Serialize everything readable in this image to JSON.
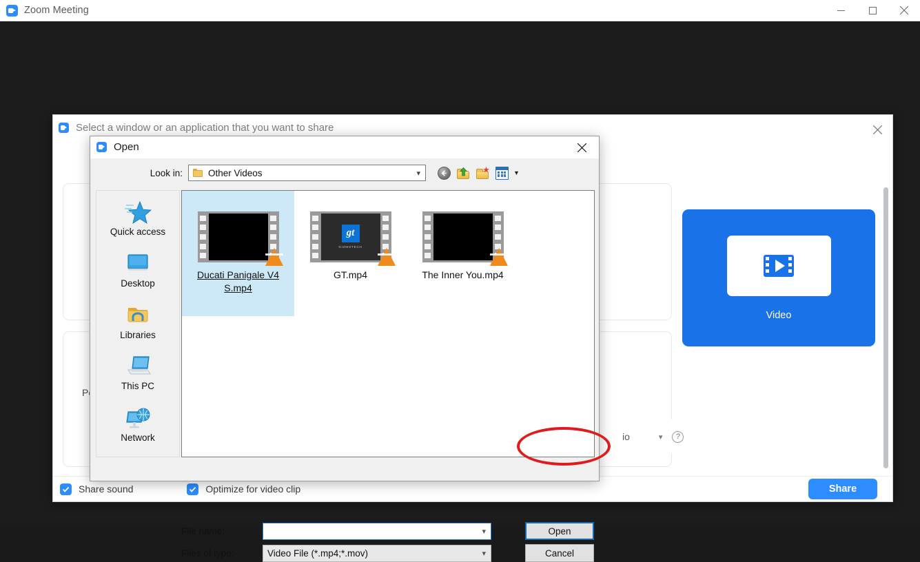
{
  "os_window": {
    "title": "Zoom Meeting",
    "logo_icon": "zoom-logo-icon",
    "controls": {
      "minimize": "minimize-icon",
      "maximize": "maximize-icon",
      "close": "close-icon"
    }
  },
  "share_window": {
    "title": "Select a window or an application that you want to share",
    "logo_icon": "zoom-logo-icon",
    "close_icon": "close-icon",
    "partial_panel_label": "Po",
    "audio_partial_text": "io",
    "audio_chevron_icon": "chevron-down-icon",
    "help_icon": "question-mark-icon",
    "video_tile": {
      "label": "Video",
      "icon": "video-film-play-icon",
      "accent": "#1a72e8"
    },
    "scrollbar": "vertical-scrollbar",
    "footer": {
      "share_sound_label": "Share sound",
      "optimize_label": "Optimize for video clip",
      "share_button": "Share",
      "checkbox_accent": "#2d8cff"
    }
  },
  "open_dialog": {
    "title": "Open",
    "logo_icon": "zoom-logo-icon",
    "close_icon": "close-icon",
    "look_in": {
      "label": "Look in:",
      "value": "Other Videos",
      "folder_icon": "folder-icon",
      "chevron_icon": "chevron-down-icon"
    },
    "toolbar": [
      {
        "name": "back-icon",
        "title": "Back"
      },
      {
        "name": "up-one-level-icon",
        "title": "Up One Level"
      },
      {
        "name": "new-folder-icon",
        "title": "Create New Folder"
      },
      {
        "name": "view-menu-icon",
        "title": "View Menu"
      }
    ],
    "places": [
      {
        "label": "Quick access",
        "icon": "star-icon"
      },
      {
        "label": "Desktop",
        "icon": "desktop-icon"
      },
      {
        "label": "Libraries",
        "icon": "libraries-folder-icon"
      },
      {
        "label": "This PC",
        "icon": "computer-icon"
      },
      {
        "label": "Network",
        "icon": "network-globe-icon"
      }
    ],
    "files": [
      {
        "name": "Ducati Panigale V4 S.mp4",
        "selected": true,
        "thumb": "moto",
        "overlay_icon": "vlc-cone-icon"
      },
      {
        "name": "GT.mp4",
        "selected": false,
        "thumb": "gt",
        "overlay_icon": "vlc-cone-icon",
        "thumb_text": "gt",
        "thumb_caption": "GIZMOTECH"
      },
      {
        "name": "The Inner You.mp4",
        "selected": false,
        "thumb": "inner",
        "overlay_icon": "vlc-cone-icon"
      }
    ],
    "file_name": {
      "label": "File name:",
      "value": "",
      "placeholder": "",
      "chevron_icon": "chevron-down-icon"
    },
    "files_of_type": {
      "label": "Files of type:",
      "value": "Video File (*.mp4;*.mov)",
      "chevron_icon": "chevron-down-icon"
    },
    "buttons": {
      "open": "Open",
      "cancel": "Cancel",
      "open_focus_color": "#0f6cbd"
    }
  },
  "annotation": {
    "type": "ellipse-highlight",
    "target": "open-button",
    "color": "#e01b1b"
  }
}
